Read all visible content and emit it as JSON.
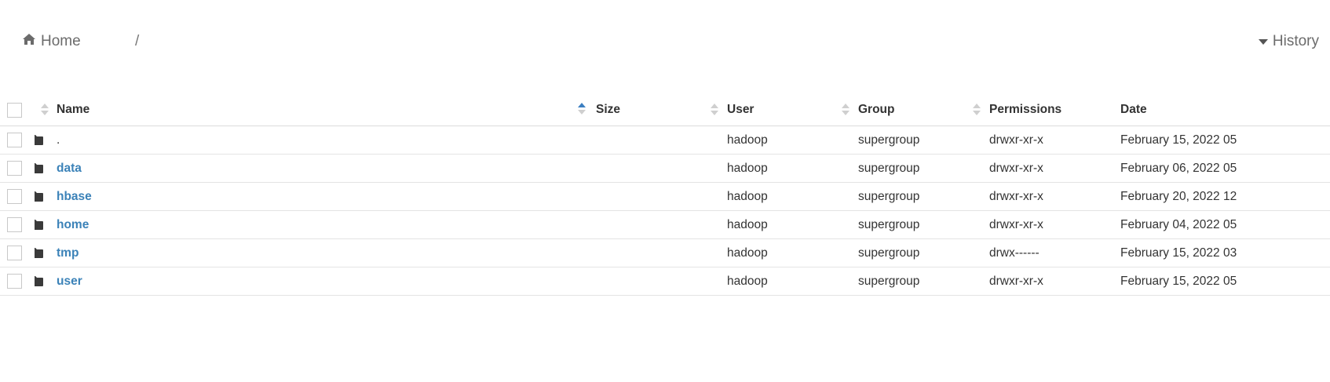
{
  "breadcrumb": {
    "home_label": "Home",
    "separator": "/",
    "home_icon": "home-icon"
  },
  "history": {
    "label": "History",
    "icon": "caret-down-icon"
  },
  "table": {
    "sorted_by": "Name",
    "sort_direction": "ascending",
    "headers": {
      "name": "Name",
      "size": "Size",
      "user": "User",
      "group": "Group",
      "permissions": "Permissions",
      "date": "Date"
    },
    "rows": [
      {
        "name": ".",
        "is_link": false,
        "size": "",
        "user": "hadoop",
        "group": "supergroup",
        "permissions": "drwxr-xr-x",
        "date": "February 15, 2022 05"
      },
      {
        "name": "data",
        "is_link": true,
        "size": "",
        "user": "hadoop",
        "group": "supergroup",
        "permissions": "drwxr-xr-x",
        "date": "February 06, 2022 05"
      },
      {
        "name": "hbase",
        "is_link": true,
        "size": "",
        "user": "hadoop",
        "group": "supergroup",
        "permissions": "drwxr-xr-x",
        "date": "February 20, 2022 12"
      },
      {
        "name": "home",
        "is_link": true,
        "size": "",
        "user": "hadoop",
        "group": "supergroup",
        "permissions": "drwxr-xr-x",
        "date": "February 04, 2022 05"
      },
      {
        "name": "tmp",
        "is_link": true,
        "size": "",
        "user": "hadoop",
        "group": "supergroup",
        "permissions": "drwx------",
        "date": "February 15, 2022 03"
      },
      {
        "name": "user",
        "is_link": true,
        "size": "",
        "user": "hadoop",
        "group": "supergroup",
        "permissions": "drwxr-xr-x",
        "date": "February 15, 2022 05"
      }
    ]
  },
  "colors": {
    "link": "#3b82b8",
    "sort_active": "#3c7fc1",
    "folder_icon": "#3a3a3a"
  }
}
